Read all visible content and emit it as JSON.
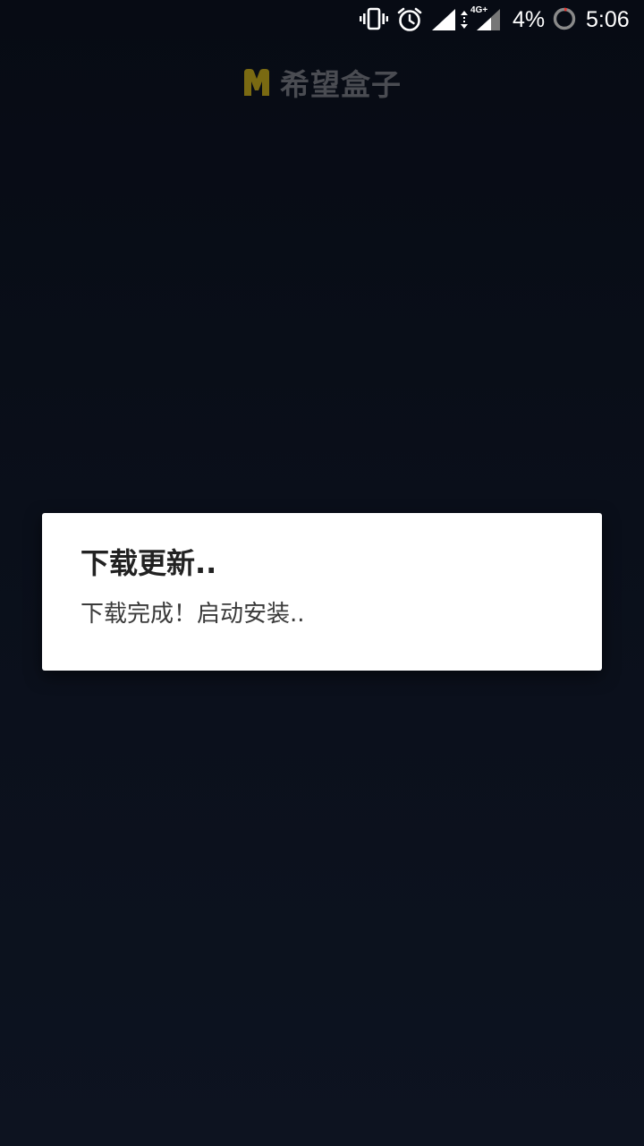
{
  "status_bar": {
    "battery_percent": "4%",
    "time": "5:06",
    "network_type": "4G+",
    "icons": [
      "vibrate-icon",
      "alarm-icon",
      "signal-icon",
      "data-arrows-icon",
      "signal-icon",
      "battery-ring-icon"
    ]
  },
  "app": {
    "brand_name": "希望盒子",
    "logo_icon": "m-logo-icon",
    "logo_color": "#7a6a12"
  },
  "dialog": {
    "title": "下载更新..",
    "message": "下载完成！启动安装.."
  },
  "colors": {
    "background": "#0a0f1a",
    "dialog_background": "#ffffff",
    "brand_text": "#4a4c52",
    "battery_ring_low": "#e53935"
  }
}
